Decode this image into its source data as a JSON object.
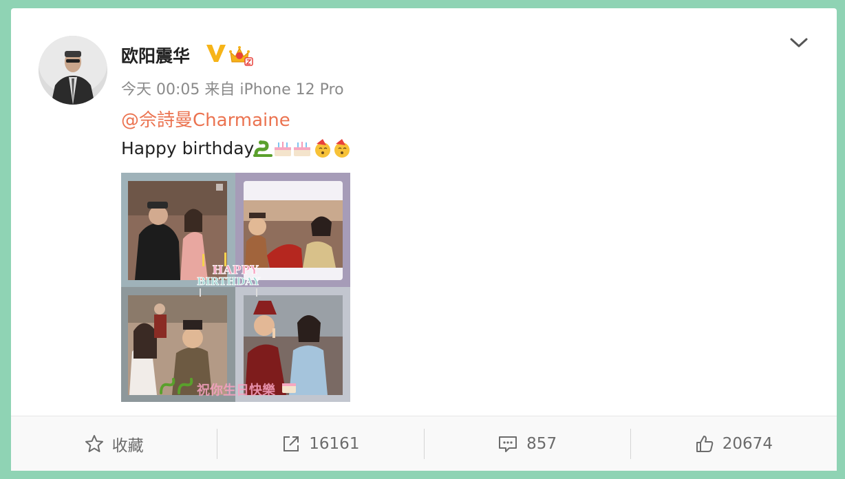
{
  "post": {
    "author": "欧阳震华",
    "meta": "今天 00:05 来自 iPhone 12 Pro",
    "mention": "@佘詩曼Charmaine",
    "text": "Happy birthday ",
    "image": {
      "overlay_title_1": "HAPPY",
      "overlay_title_2": "BIRTHDAY",
      "caption": "祝你生日快樂"
    }
  },
  "actions": {
    "favorite_label": "收藏",
    "repost_count": "16161",
    "comment_count": "857",
    "like_count": "20674"
  },
  "colors": {
    "background": "#8fd3b4",
    "mention": "#eb7350",
    "verified_badge": "#f6b418"
  },
  "icons": [
    "verified-badge-icon",
    "vip-crown-icon",
    "chevron-down-icon",
    "star-icon",
    "share-icon",
    "comment-icon",
    "thumbs-up-icon"
  ]
}
